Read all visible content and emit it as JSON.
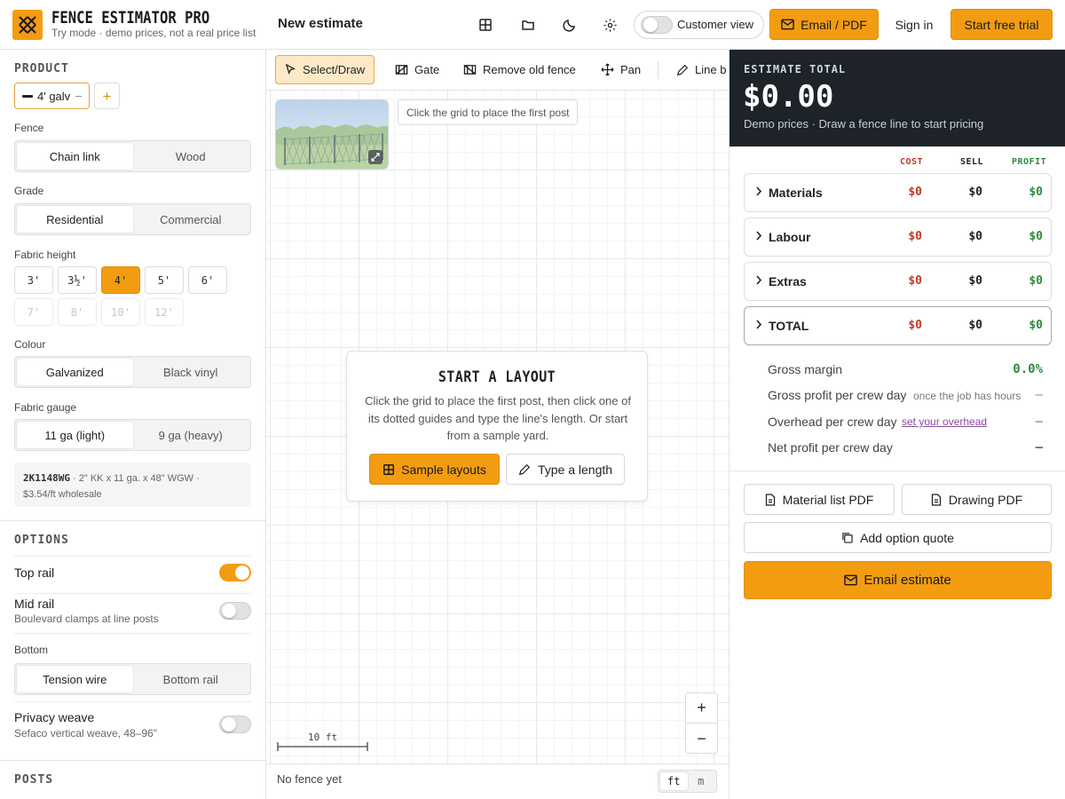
{
  "header": {
    "brand_title": "FENCE ESTIMATOR PRO",
    "brand_subtitle": "Try mode · demo prices, not a real price list",
    "doc_title": "New estimate",
    "customer_view_label": "Customer view",
    "email_pdf_label": "Email / PDF",
    "sign_in_label": "Sign in",
    "trial_label": "Start free trial",
    "accent_color": "#f39c12"
  },
  "sidebar": {
    "product_title": "PRODUCT",
    "product_chip": "4' galv",
    "fence_label": "Fence",
    "fence_options": [
      "Chain link",
      "Wood"
    ],
    "grade_label": "Grade",
    "grade_options": [
      "Residential",
      "Commercial"
    ],
    "height_label": "Fabric height",
    "heights_row1": [
      "3'",
      "3½'",
      "4'",
      "5'",
      "6'"
    ],
    "heights_row2": [
      "7'",
      "8'",
      "10'",
      "12'"
    ],
    "colour_label": "Colour",
    "colour_options": [
      "Galvanized",
      "Black vinyl"
    ],
    "gauge_label": "Fabric gauge",
    "gauge_options": [
      "11 ga (light)",
      "9 ga (heavy)"
    ],
    "sku": "2K1148WG",
    "sku_desc": " · 2\" KK x 11 ga. x 48\" WGW · ",
    "sku_price": "$3.54/ft wholesale",
    "options_title": "OPTIONS",
    "top_rail_label": "Top rail",
    "top_rail_on": true,
    "mid_rail_label": "Mid rail",
    "mid_rail_sub": "Boulevard clamps at line posts",
    "mid_rail_on": false,
    "bottom_label": "Bottom",
    "bottom_options": [
      "Tension wire",
      "Bottom rail"
    ],
    "privacy_label": "Privacy weave",
    "privacy_sub": "Sefaco vertical weave, 48–96\"",
    "privacy_on": false,
    "posts_title": "POSTS"
  },
  "toolbar": {
    "select_draw": "Select/Draw",
    "gate": "Gate",
    "remove_old": "Remove old fence",
    "pan": "Pan",
    "line_b": "Line b"
  },
  "canvas": {
    "hint": "Click the grid to place the first post",
    "card_title": "START A LAYOUT",
    "card_text": "Click the grid to place the first post, then click one of its dotted guides and type the line's length. Or start from a sample yard.",
    "sample_layouts": "Sample layouts",
    "type_length": "Type a length",
    "scale_label": "10 ft",
    "zoom_in": "+",
    "zoom_out": "−",
    "status": "No fence yet",
    "units": [
      "ft",
      "m"
    ]
  },
  "estimate": {
    "label": "ESTIMATE TOTAL",
    "total": "$0.00",
    "subtitle": "Demo prices · Draw a fence line to start pricing",
    "col_cost": "COST",
    "col_sell": "SELL",
    "col_profit": "PROFIT",
    "cost_color": "#c0392b",
    "profit_color": "#2e8b3e",
    "rows": [
      {
        "label": "Materials",
        "cost": "$0",
        "sell": "$0",
        "profit": "$0"
      },
      {
        "label": "Labour",
        "cost": "$0",
        "sell": "$0",
        "profit": "$0"
      },
      {
        "label": "Extras",
        "cost": "$0",
        "sell": "$0",
        "profit": "$0"
      },
      {
        "label": "TOTAL",
        "cost": "$0",
        "sell": "$0",
        "profit": "$0"
      }
    ],
    "gross_margin_label": "Gross margin",
    "gross_margin_value": "0.0%",
    "gp_crew_label": "Gross profit per crew day",
    "gp_crew_hint": "once the job has hours",
    "gp_crew_value": "—",
    "overhead_label": "Overhead per crew day",
    "overhead_link": "set your overhead",
    "overhead_value": "—",
    "net_label": "Net profit per crew day",
    "net_value": "—",
    "material_pdf": "Material list PDF",
    "drawing_pdf": "Drawing PDF",
    "option_quote": "Add option quote",
    "email_estimate": "Email estimate"
  }
}
